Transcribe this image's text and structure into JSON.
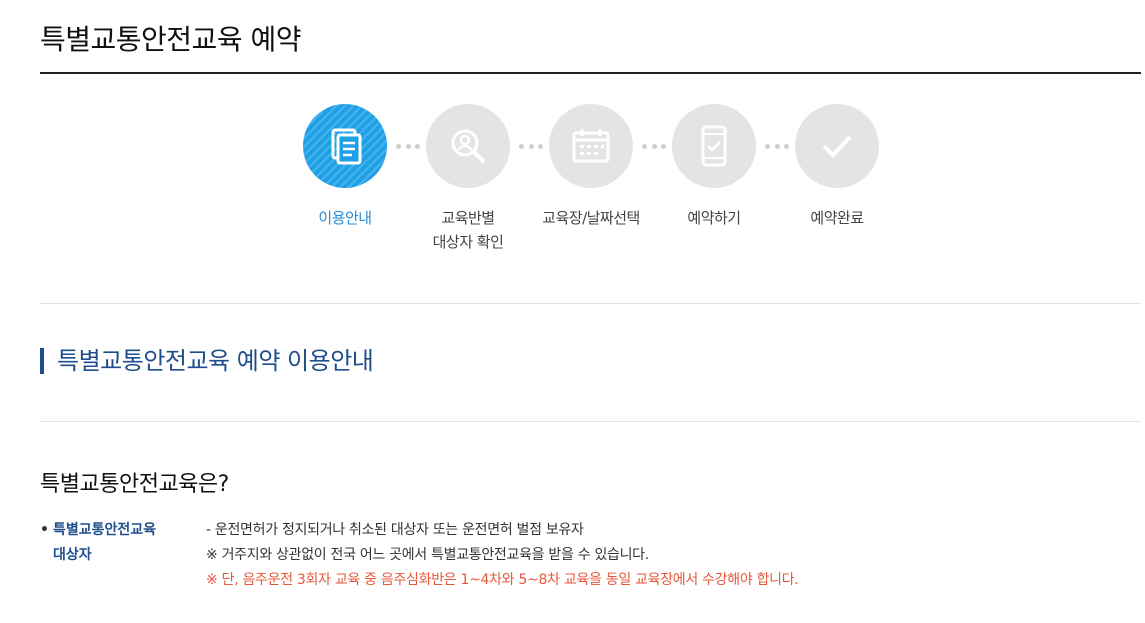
{
  "page": {
    "title": "특별교통안전교육 예약"
  },
  "steps": [
    {
      "label_line1": "이용안내",
      "label_line2": "",
      "icon": "document-icon",
      "active": true
    },
    {
      "label_line1": "교육반별",
      "label_line2": "대상자 확인",
      "icon": "search-person-icon",
      "active": false
    },
    {
      "label_line1": "교육장/날짜선택",
      "label_line2": "",
      "icon": "calendar-icon",
      "active": false
    },
    {
      "label_line1": "예약하기",
      "label_line2": "",
      "icon": "mobile-check-icon",
      "active": false
    },
    {
      "label_line1": "예약완료",
      "label_line2": "",
      "icon": "check-icon",
      "active": false
    }
  ],
  "section": {
    "title": "특별교통안전교육 예약 이용안내"
  },
  "intro": {
    "heading": "특별교통안전교육은?",
    "term_bullet": "•",
    "term_line1": "특별교통안전교육",
    "term_line2": "대상자",
    "desc_line1": "- 운전면허가 정지되거나 취소된 대상자 또는 운전면허 벌점 보유자",
    "desc_line2": "※ 거주지와 상관없이 전국 어느 곳에서 특별교통안전교육을 받을 수 있습니다.",
    "desc_line3": "※ 단, 음주운전 3회자 교육 중 음주심화반은 1~4차와 5~8차 교육을 동일 교육장에서 수강해야 합니다."
  },
  "colors": {
    "active_step": "#1ea0e6",
    "inactive_step": "#e4e4e4",
    "accent_blue": "#1f4e8c",
    "warning": "#e8573a"
  }
}
